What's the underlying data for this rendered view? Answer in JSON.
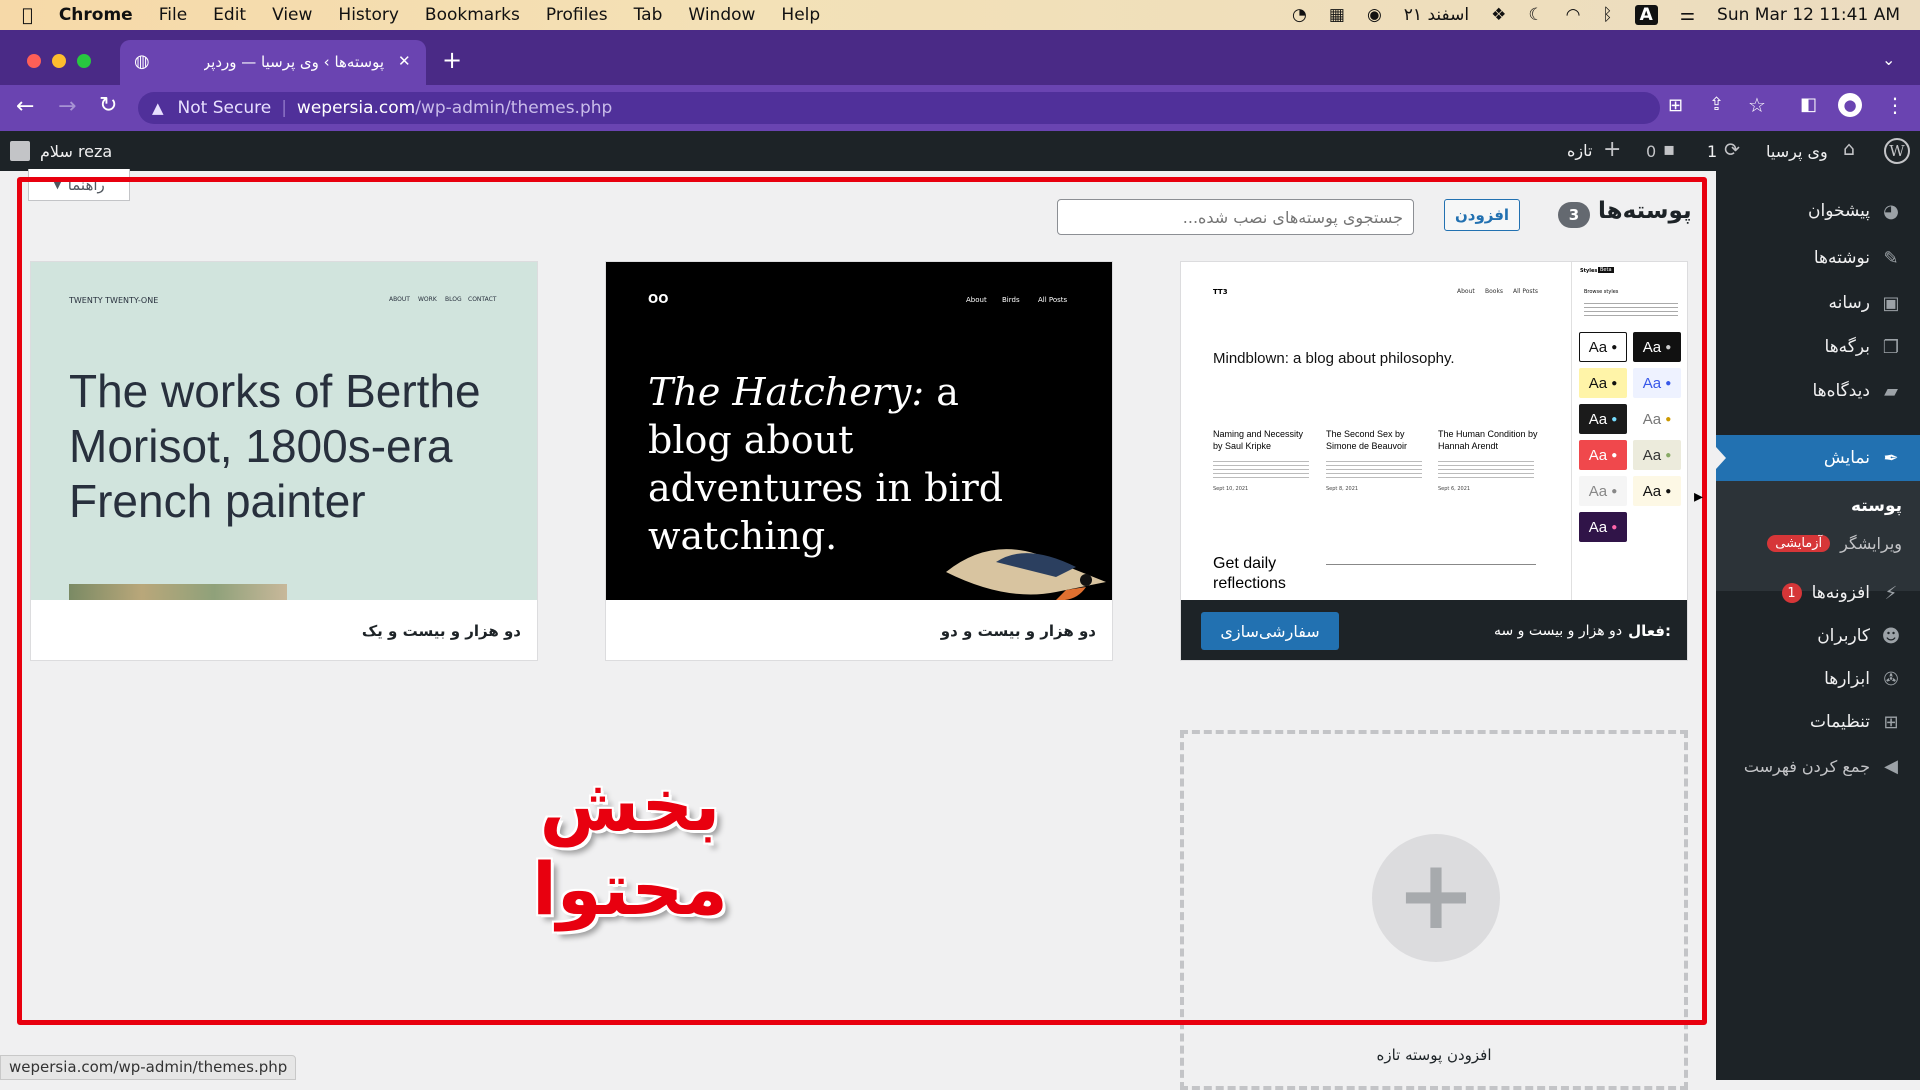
{
  "menubar": {
    "apple": "",
    "app": "Chrome",
    "items": [
      "File",
      "Edit",
      "View",
      "History",
      "Bookmarks",
      "Profiles",
      "Tab",
      "Window",
      "Help"
    ],
    "date_fa": "۲۱ اسفند",
    "input_badge": "A",
    "datetime": "Sun Mar 12  11:41 AM"
  },
  "browser": {
    "tab_title": "پوسته‌ها › وی پرسیا — وردپرس",
    "tab_close": "✕",
    "new_tab": "+",
    "security": "Not Secure",
    "url_host": "wepersia.com",
    "url_path": "/wp-admin/themes.php",
    "status_url": "wepersia.com/wp-admin/themes.php"
  },
  "adminbar": {
    "site": "وی پرسیا",
    "updates": "1",
    "comments": "0",
    "new": "تازه",
    "greeting": "سلام reza"
  },
  "sidebar": {
    "items": [
      {
        "label": "پیشخوان",
        "icon": "dashboard-icon"
      },
      {
        "label": "نوشته‌ها",
        "icon": "pin-icon"
      },
      {
        "label": "رسانه",
        "icon": "media-icon"
      },
      {
        "label": "برگه‌ها",
        "icon": "pages-icon"
      },
      {
        "label": "دیدگاه‌ها",
        "icon": "comments-icon"
      },
      {
        "label": "نمایش",
        "icon": "appearance-icon"
      },
      {
        "label": "افزونه‌ها",
        "icon": "plugins-icon",
        "badge": "1"
      },
      {
        "label": "کاربران",
        "icon": "users-icon"
      },
      {
        "label": "ابزارها",
        "icon": "tools-icon"
      },
      {
        "label": "تنظیمات",
        "icon": "settings-icon"
      },
      {
        "label": "جمع کردن فهرست",
        "icon": "collapse-icon"
      }
    ],
    "sub_themes": "پوسته",
    "sub_editor": "ویرایشگر",
    "sub_editor_badge": "آزمایشی"
  },
  "page": {
    "title": "پوسته‌ها",
    "count": "3",
    "add_button": "افزودن",
    "search_placeholder": "جستجوی پوسته‌های نصب شده...",
    "help_tab": "راهنما",
    "add_new_theme": "افزودن پوسته تازه",
    "overlay_text": "بخش محتوا"
  },
  "themes": [
    {
      "name": "دو هزار و بیست و سه",
      "active_prefix": "فعال:",
      "customize": "سفارشی‌سازی",
      "preview": {
        "logo": "TT3",
        "nav": [
          "About",
          "Books",
          "All Posts"
        ],
        "headline": "Mindblown: a blog about philosophy.",
        "posts": [
          {
            "title": "Naming and Necessity by Saul Kripke",
            "date": "Sept 10, 2021"
          },
          {
            "title": "The Second Sex by Simone de Beauvoir",
            "date": "Sept 8, 2021"
          },
          {
            "title": "The Human Condition by Hannah Arendt",
            "date": "Sept 6, 2021"
          }
        ],
        "footer": "Get daily reflections",
        "panel_title": "Styles",
        "panel_badge": "Beta",
        "panel_sub": "Browse styles",
        "swatch_label": "Aa"
      }
    },
    {
      "name": "دو هزار و بیست و دو",
      "preview": {
        "logo": "OO",
        "nav": [
          "About",
          "Birds",
          "All Posts"
        ],
        "headline_italic": "The Hatchery:",
        "headline": " a blog about adventures in bird watching."
      }
    },
    {
      "name": "دو هزار و بیست و یک",
      "preview": {
        "logo": "TWENTY TWENTY-ONE",
        "nav": [
          "ABOUT",
          "WORK",
          "BLOG",
          "CONTACT"
        ],
        "headline": "The works of Berthe Morisot, 1800s-era French painter"
      }
    }
  ]
}
